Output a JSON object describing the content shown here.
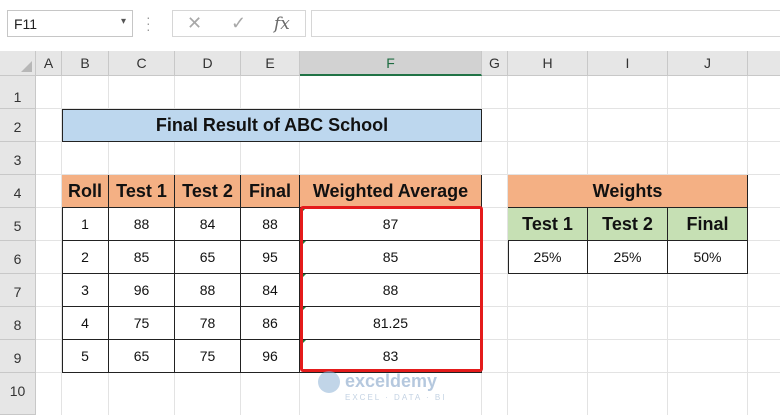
{
  "formula_bar": {
    "name_box": "F11",
    "formula": ""
  },
  "columns": [
    "A",
    "B",
    "C",
    "D",
    "E",
    "F",
    "G",
    "H",
    "I",
    "J"
  ],
  "selected_column": "F",
  "rows": [
    "1",
    "2",
    "3",
    "4",
    "5",
    "6",
    "7",
    "8",
    "9",
    "10"
  ],
  "title": "Final Result of ABC School",
  "results_table": {
    "headers": [
      "Roll",
      "Test 1",
      "Test 2",
      "Final",
      "Weighted Average"
    ],
    "rows": [
      [
        "1",
        "88",
        "84",
        "88",
        "87"
      ],
      [
        "2",
        "85",
        "65",
        "95",
        "85"
      ],
      [
        "3",
        "96",
        "88",
        "84",
        "88"
      ],
      [
        "4",
        "75",
        "78",
        "86",
        "81.25"
      ],
      [
        "5",
        "65",
        "75",
        "96",
        "83"
      ]
    ]
  },
  "weights_table": {
    "title": "Weights",
    "headers": [
      "Test 1",
      "Test 2",
      "Final"
    ],
    "values": [
      "25%",
      "25%",
      "50%"
    ]
  },
  "watermark": {
    "name": "exceldemy",
    "tagline": "EXCEL · DATA · BI"
  },
  "colors": {
    "title_fill": "#bdd7ee",
    "header_fill": "#f4b084",
    "weights_header_fill": "#c6e0b4",
    "highlight_border": "#e41b1b",
    "selected_column_accent": "#217346"
  },
  "icons": [
    "cancel-icon",
    "enter-icon",
    "function-icon",
    "dropdown-icon"
  ]
}
